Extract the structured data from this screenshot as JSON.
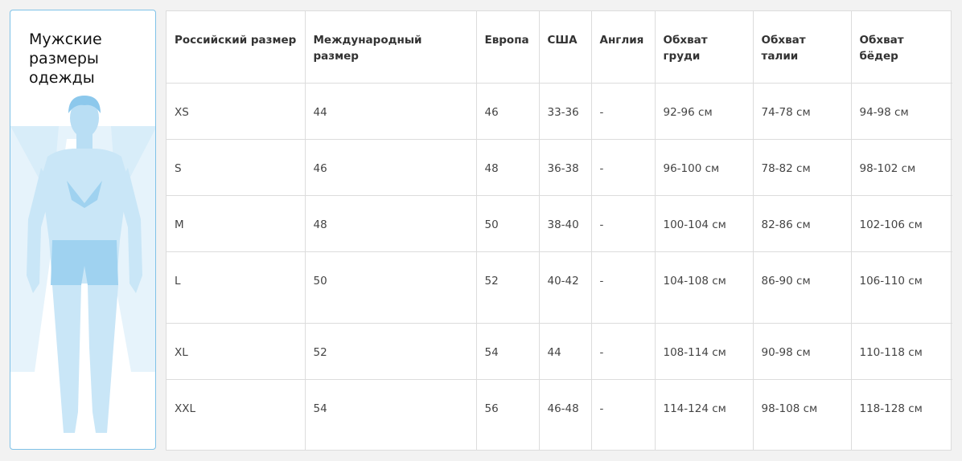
{
  "sidebar": {
    "title": "Мужские\nразмеры\nодежды",
    "figure_icon": "male-body-silhouette",
    "accent_color": "#7fc2e8"
  },
  "table": {
    "columns": [
      "Российский размер",
      "Международный размер",
      "Европа",
      "США",
      "Англия",
      "Обхват груди",
      "Обхват талии",
      "Обхват бёдер"
    ],
    "rows": [
      [
        "XS",
        "44",
        "46",
        "33-36",
        "-",
        "92-96 см",
        "74-78 см",
        "94-98 см"
      ],
      [
        "S",
        "46",
        "48",
        "36-38",
        "-",
        "96-100 см",
        "78-82 см",
        "98-102 см"
      ],
      [
        "M",
        "48",
        "50",
        "38-40",
        "-",
        "100-104 см",
        "82-86 см",
        "102-106 см"
      ],
      [
        "L",
        "50",
        "52",
        "40-42",
        "-",
        "104-108 см",
        "86-90 см",
        "106-110 см"
      ],
      [
        "XL",
        "52",
        "54",
        "44",
        "-",
        "108-114 см",
        "90-98 см",
        "110-118 см"
      ],
      [
        "XXL",
        "54",
        "56",
        "46-48",
        "-",
        "114-124 см",
        "98-108 см",
        "118-128 см"
      ]
    ]
  }
}
